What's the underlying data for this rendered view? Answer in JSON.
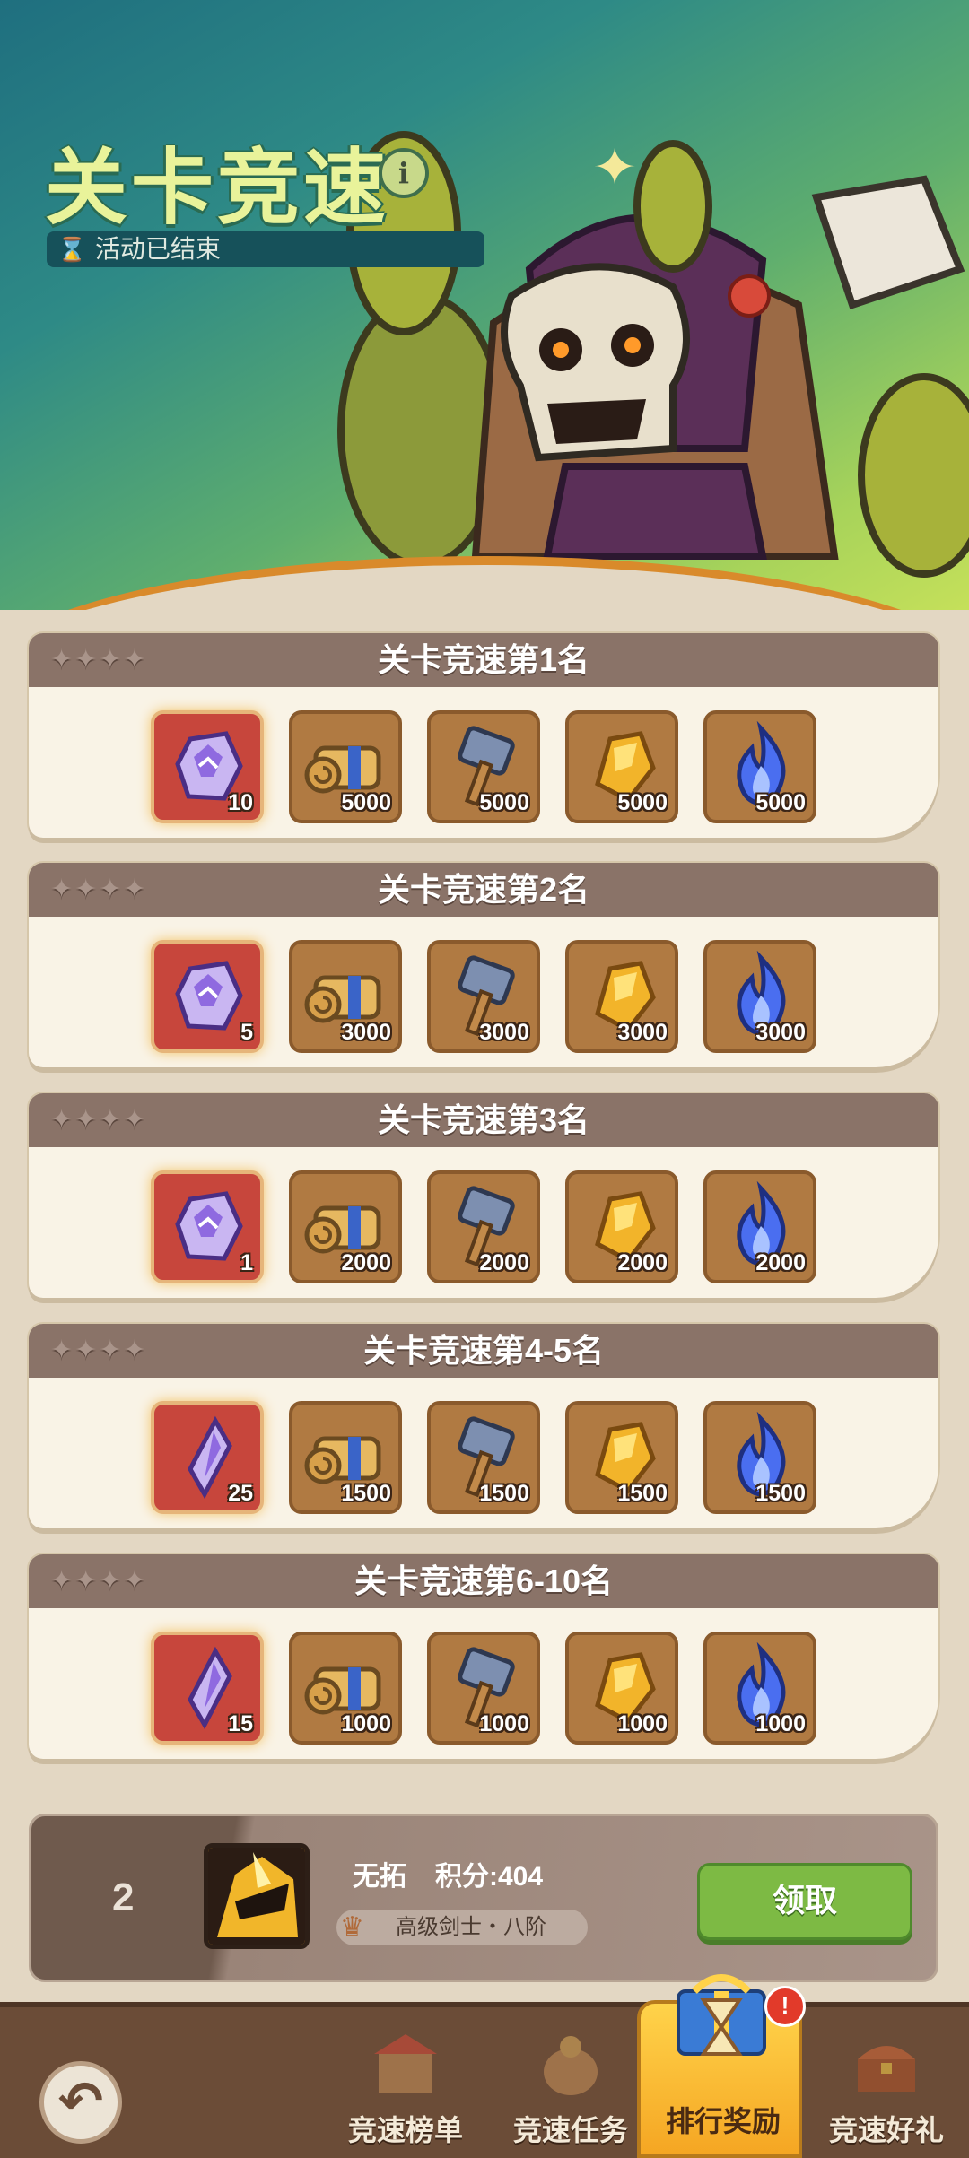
{
  "header": {
    "title": "关卡竞速",
    "status": "活动已结束"
  },
  "ranks": [
    {
      "title": "关卡竞速第1名",
      "items": [
        {
          "icon": "purple-crystal-icon",
          "count": "10",
          "highlight": true
        },
        {
          "icon": "scroll-icon",
          "count": "5000"
        },
        {
          "icon": "hammer-icon",
          "count": "5000"
        },
        {
          "icon": "gold-ore-icon",
          "count": "5000"
        },
        {
          "icon": "blue-flame-icon",
          "count": "5000"
        }
      ]
    },
    {
      "title": "关卡竞速第2名",
      "items": [
        {
          "icon": "purple-crystal-icon",
          "count": "5",
          "highlight": true
        },
        {
          "icon": "scroll-icon",
          "count": "3000"
        },
        {
          "icon": "hammer-icon",
          "count": "3000"
        },
        {
          "icon": "gold-ore-icon",
          "count": "3000"
        },
        {
          "icon": "blue-flame-icon",
          "count": "3000"
        }
      ]
    },
    {
      "title": "关卡竞速第3名",
      "items": [
        {
          "icon": "purple-crystal-icon",
          "count": "1",
          "highlight": true
        },
        {
          "icon": "scroll-icon",
          "count": "2000"
        },
        {
          "icon": "hammer-icon",
          "count": "2000"
        },
        {
          "icon": "gold-ore-icon",
          "count": "2000"
        },
        {
          "icon": "blue-flame-icon",
          "count": "2000"
        }
      ]
    },
    {
      "title": "关卡竞速第4-5名",
      "items": [
        {
          "icon": "crystal-shard-icon",
          "count": "25",
          "highlight": true
        },
        {
          "icon": "scroll-icon",
          "count": "1500"
        },
        {
          "icon": "hammer-icon",
          "count": "1500"
        },
        {
          "icon": "gold-ore-icon",
          "count": "1500"
        },
        {
          "icon": "blue-flame-icon",
          "count": "1500"
        }
      ]
    },
    {
      "title": "关卡竞速第6-10名",
      "items": [
        {
          "icon": "crystal-shard-icon",
          "count": "15",
          "highlight": true
        },
        {
          "icon": "scroll-icon",
          "count": "1000"
        },
        {
          "icon": "hammer-icon",
          "count": "1000"
        },
        {
          "icon": "gold-ore-icon",
          "count": "1000"
        },
        {
          "icon": "blue-flame-icon",
          "count": "1000"
        }
      ]
    }
  ],
  "player": {
    "rank": "2",
    "name": "无拓",
    "score": "积分:404",
    "title": "高级剑士・八阶",
    "claim_label": "领取"
  },
  "nav": {
    "tabs": [
      {
        "label": "竞速榜单",
        "icon": "market-stall-icon"
      },
      {
        "label": "竞速任务",
        "icon": "quest-bag-icon"
      },
      {
        "label": "排行奖励",
        "icon": "gift-hourglass-icon",
        "active": true,
        "badge": "!"
      },
      {
        "label": "竞速好礼",
        "icon": "treasure-chest-icon"
      }
    ]
  },
  "colors": {
    "card_header": "#8a7368",
    "card_body": "#f9f3e6",
    "item_brown": "#b07a42",
    "item_red": "#c7463c",
    "claim_green": "#7dba44",
    "nav_bg": "#6b4c37",
    "active_tab": "#f5a623"
  }
}
